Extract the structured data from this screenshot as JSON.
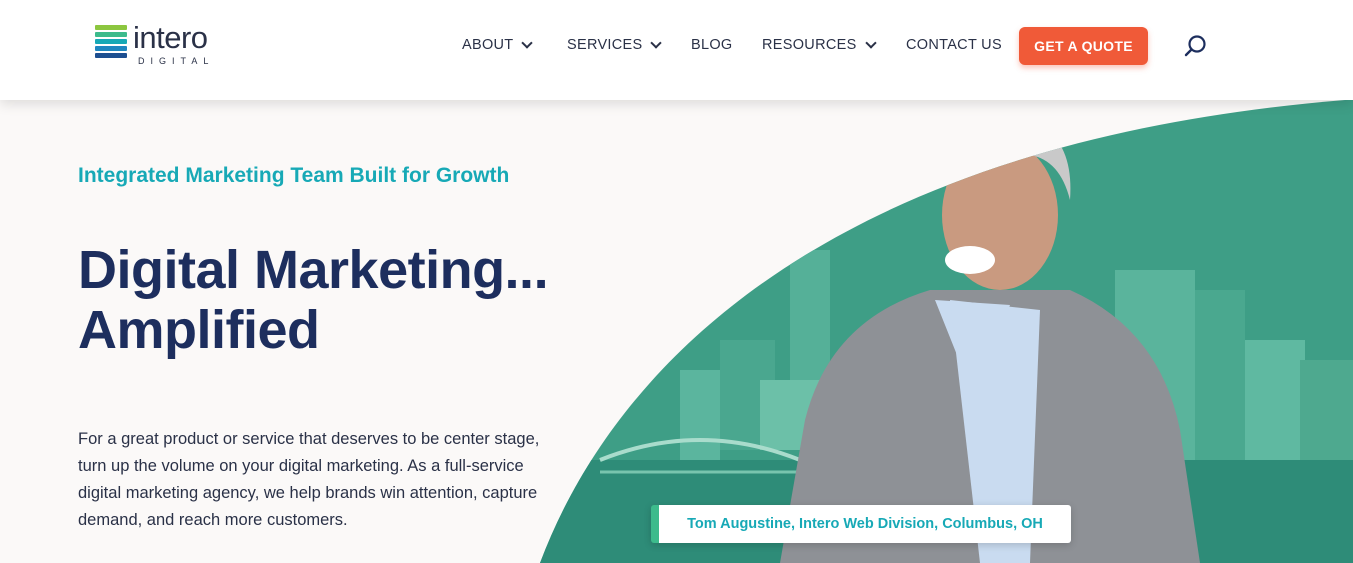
{
  "brand": {
    "name": "intero",
    "sub": "DIGITAL",
    "bar_colors": [
      "#8cc63f",
      "#3dbb8c",
      "#17a9b6",
      "#1f86c0",
      "#1d4f91"
    ]
  },
  "nav": {
    "items": [
      {
        "label": "ABOUT",
        "dropdown": true
      },
      {
        "label": "SERVICES",
        "dropdown": true
      },
      {
        "label": "BLOG",
        "dropdown": false
      },
      {
        "label": "RESOURCES",
        "dropdown": true
      },
      {
        "label": "CONTACT US",
        "dropdown": false
      }
    ],
    "cta_label": "GET A QUOTE",
    "search_icon": "search-icon"
  },
  "hero": {
    "eyebrow": "Integrated Marketing Team Built for Growth",
    "headline_line1": "Digital Marketing...",
    "headline_line2": "Amplified",
    "body": "For a great product or service that deserves to be center stage, turn up the volume on your digital marketing. As a full-service digital marketing agency, we help brands win attention, capture demand, and reach more customers.",
    "caption": "Tom Augustine, Intero Web Division, Columbus, OH"
  },
  "colors": {
    "accent": "#f05a38",
    "teal": "#17a9b6",
    "navy": "#1d2e5e",
    "green_overlay": "#3a9e86"
  }
}
